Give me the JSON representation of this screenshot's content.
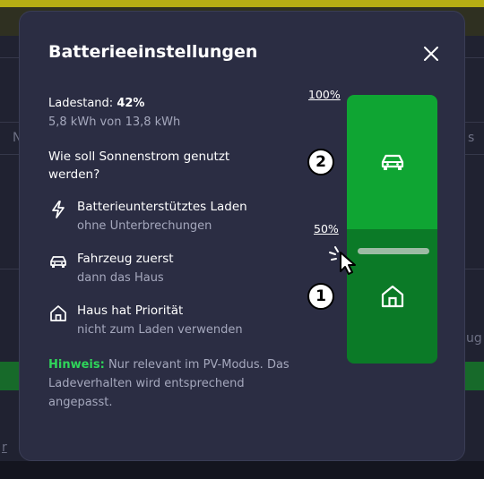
{
  "background": {
    "fragment_left_top": "N",
    "fragment_right_top": "s",
    "fragment_right_mid": "ug",
    "fragment_left_bottom": "r"
  },
  "modal": {
    "title": "Batterieeinstellungen",
    "close_icon": "close-icon",
    "charge_label": "Ladestand:",
    "charge_value": "42%",
    "energy_text": "5,8 kWh von 13,8 kWh",
    "question": "Wie soll Sonnenstrom genutzt werden?",
    "options": [
      {
        "icon": "bolt-icon",
        "title": "Batterieunterstütztes Laden",
        "subtitle": "ohne Unterbrechungen"
      },
      {
        "icon": "car-icon",
        "title": "Fahrzeug zuerst",
        "subtitle": "dann das Haus"
      },
      {
        "icon": "house-icon",
        "title": "Haus hat Priorität",
        "subtitle": "nicht zum Laden verwenden"
      }
    ],
    "note_label": "Hinweis:",
    "note_text": " Nur relevant im PV-Modus. Das Ladeverhalten wird entsprechend angepasst."
  },
  "battery_bar": {
    "label_top": "100%",
    "label_mid": "50%",
    "threshold_percent": 50,
    "zone_upper_icon": "car-icon",
    "zone_lower_icon": "house-icon",
    "badge_upper": "2",
    "badge_lower": "1",
    "color_upper": "#0fa533",
    "color_lower": "#0b7a27"
  },
  "colors": {
    "accent_green": "#2fd65a",
    "modal_bg": "#2b2d43"
  }
}
